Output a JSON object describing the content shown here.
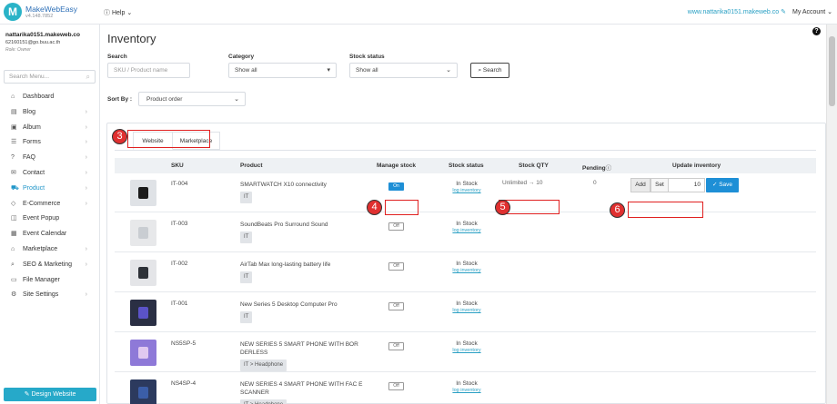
{
  "brand": {
    "name": "MakeWebEasy",
    "version": "v4.148.7852",
    "logo_letter": "M"
  },
  "topbar": {
    "help_label": "Help",
    "site_link": "www.nattarika0151.makeweb.co",
    "my_account": "My Account"
  },
  "user": {
    "site": "nattarika0151.makeweb.co",
    "email": "62160151@go.buu.ac.th",
    "role": "Role: Owner"
  },
  "sidebar": {
    "search_placeholder": "Search Menu...",
    "items": [
      {
        "label": "Dashboard",
        "icon": "⌂",
        "chevron": ""
      },
      {
        "label": "Blog",
        "icon": "▤",
        "chevron": "›"
      },
      {
        "label": "Album",
        "icon": "▣",
        "chevron": "›"
      },
      {
        "label": "Forms",
        "icon": "☰",
        "chevron": "›"
      },
      {
        "label": "FAQ",
        "icon": "?",
        "chevron": "›"
      },
      {
        "label": "Contact",
        "icon": "✉",
        "chevron": "›"
      },
      {
        "label": "Product",
        "icon": "⛟",
        "chevron": "›"
      },
      {
        "label": "E-Commerce",
        "icon": "◇",
        "chevron": "›"
      },
      {
        "label": "Event Popup",
        "icon": "◫",
        "chevron": ""
      },
      {
        "label": "Event Calendar",
        "icon": "▦",
        "chevron": ""
      },
      {
        "label": "Marketplace",
        "icon": "⌂",
        "chevron": "›"
      },
      {
        "label": "SEO & Marketing",
        "icon": "⌕",
        "chevron": "›"
      },
      {
        "label": "File Manager",
        "icon": "▭",
        "chevron": ""
      },
      {
        "label": "Site Settings",
        "icon": "⚙",
        "chevron": "›"
      }
    ],
    "active_index": 6,
    "design_button": "Design Website"
  },
  "page": {
    "title": "Inventory"
  },
  "filters": {
    "search_label": "Search",
    "search_placeholder": "SKU / Product name",
    "category_label": "Category",
    "category_value": "Show all",
    "stock_label": "Stock status",
    "stock_value": "Show all",
    "search_button": "Search",
    "sortby_label": "Sort By :",
    "sortby_value": "Product order"
  },
  "tabs": [
    "Website",
    "Marketplace"
  ],
  "annotations": [
    "3",
    "4",
    "5",
    "6"
  ],
  "table": {
    "headers": [
      "SKU",
      "Product",
      "Manage stock",
      "Stock status",
      "Stock QTY",
      "Pending",
      "Update inventory"
    ],
    "rows": [
      {
        "sku": "IT-004",
        "name": "SMARTWATCH X10 connectivity",
        "category": "IT",
        "manage": "On",
        "status": "In Stock",
        "log": "log inventory",
        "qty": "Unlimited → 10",
        "pending": "0",
        "add": "Add",
        "set": "Set",
        "value": "10",
        "save": "Save"
      },
      {
        "sku": "IT-003",
        "name": "SoundBeats Pro Surround Sound",
        "category": "IT",
        "manage": "Off",
        "status": "In Stock",
        "log": "log inventory"
      },
      {
        "sku": "IT-002",
        "name": "AirTab Max long-lasting battery life",
        "category": "IT",
        "manage": "Off",
        "status": "In Stock",
        "log": "log inventory"
      },
      {
        "sku": "IT-001",
        "name": "New Series 5 Desktop Computer Pro",
        "category": "IT",
        "manage": "Off",
        "status": "In Stock",
        "log": "log inventory"
      },
      {
        "sku": "NS5SP-5",
        "name": "NEW SERIES 5 SMART PHONE WITH BOR DERLESS",
        "category": "IT > Headphone",
        "manage": "Off",
        "status": "In Stock",
        "log": "log inventory"
      },
      {
        "sku": "NS4SP-4",
        "name": "NEW SERIES 4 SMART PHONE WITH FAC E SCANNER",
        "category": "IT > Headphone",
        "manage": "Off",
        "status": "In Stock",
        "log": "log inventory"
      }
    ]
  },
  "colors": {
    "accent": "#1e8fd6",
    "brand": "#2ab3c7",
    "annotation": "#e03030"
  }
}
